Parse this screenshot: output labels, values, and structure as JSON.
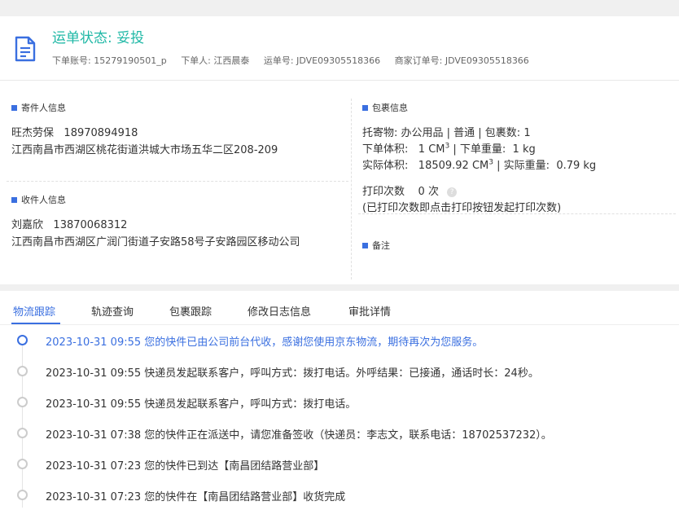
{
  "header": {
    "status_title": "运单状态: 妥投",
    "order_account_label": "下单账号:",
    "order_account": "15279190501_p",
    "orderer_label": "下单人:",
    "orderer": "江西晨泰",
    "waybill_label": "运单号:",
    "waybill": "JDVE09305518366",
    "merchant_order_label": "商家订单号:",
    "merchant_order": "JDVE09305518366"
  },
  "sender": {
    "section_title": "寄件人信息",
    "name": "旺杰劳保",
    "phone": "18970894918",
    "address": "江西南昌市西湖区桃花街道洪城大市场五华二区208-209"
  },
  "receiver": {
    "section_title": "收件人信息",
    "name": "刘嘉欣",
    "phone": "13870068312",
    "address": "江西南昌市西湖区广润门街道子安路58号子安路园区移动公司"
  },
  "package": {
    "section_title": "包裹信息",
    "goods_line": "托寄物: 办公用品 | 普通 | 包裹数: 1",
    "order_volume_label": "下单体积:",
    "order_volume": "1 CM",
    "order_weight_label": "| 下单重量:",
    "order_weight": "1 kg",
    "actual_volume_label": "实际体积:",
    "actual_volume": "18509.92 CM",
    "actual_weight_label": "| 实际重量:",
    "actual_weight": "0.79 kg",
    "cube_sup": "3",
    "print_count_label": "打印次数",
    "print_count": "0 次",
    "print_note": "(已打印次数即点击打印按钮发起打印次数)"
  },
  "remark": {
    "section_title": "备注"
  },
  "tabs": [
    "物流跟踪",
    "轨迹查询",
    "包裹跟踪",
    "修改日志信息",
    "审批详情"
  ],
  "timeline": [
    "2023-10-31 09:55 您的快件已由公司前台代收，感谢您使用京东物流，期待再次为您服务。",
    "2023-10-31 09:55 快递员发起联系客户，呼叫方式：拨打电话。外呼结果：已接通，通话时长：24秒。",
    "2023-10-31 09:55 快递员发起联系客户，呼叫方式：拨打电话。",
    "2023-10-31 07:38 您的快件正在派送中，请您准备签收（快递员：李志文，联系电话：18702537232）。",
    "2023-10-31 07:23 您的快件已到达【南昌团结路营业部】",
    "2023-10-31 07:23 您的快件在【南昌团结路营业部】收货完成"
  ],
  "colors": {
    "status": "#1fb8a6",
    "accent": "#3a6fe0"
  }
}
